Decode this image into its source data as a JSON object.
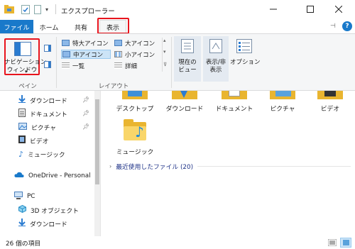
{
  "window": {
    "title": "エクスプローラー",
    "minimize_icon": "minimize-icon",
    "maximize_icon": "maximize-icon",
    "close_icon": "close-icon"
  },
  "ribbon_tabs": {
    "file": "ファイル",
    "home": "ホーム",
    "share": "共有",
    "view": "表示"
  },
  "ribbon": {
    "pane_group": {
      "label": "ペイン",
      "nav_pane_line1": "ナビゲーション",
      "nav_pane_line2": "ウィンドウ"
    },
    "layout_group": {
      "label": "レイアウト",
      "items": [
        "特大アイコン",
        "大アイコン",
        "中アイコン",
        "小アイコン",
        "一覧",
        "詳細"
      ],
      "selected": "中アイコン"
    },
    "current_view": {
      "btn1_line1": "現在の",
      "btn1_line2": "ビュー",
      "btn2_line1": "表示/非",
      "btn2_line2": "表示",
      "options": "オプション"
    }
  },
  "nav": {
    "items": [
      "ダウンロード",
      "ドキュメント",
      "ピクチャ",
      "ビデオ",
      "ミュージック",
      "OneDrive - Personal",
      "PC",
      "3D オブジェクト",
      "ダウンロード"
    ]
  },
  "content": {
    "folders_row1": [
      "デスクトップ",
      "ダウンロード",
      "ドキュメント",
      "ピクチャ",
      "ビデオ"
    ],
    "folders_row2": [
      "ミュージック"
    ],
    "recent_group": "最近使用したファイル (20)"
  },
  "status": {
    "item_count": "26 個の項目"
  },
  "colors": {
    "accent": "#1979ca",
    "highlight": "#e8141d",
    "selected": "#cce4f7",
    "folder": "#e9b530"
  }
}
